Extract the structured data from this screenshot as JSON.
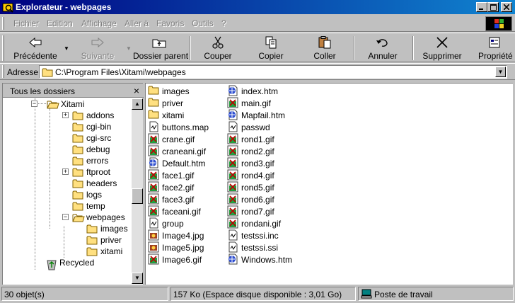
{
  "window": {
    "title": "Explorateur - webpages"
  },
  "menu": [
    "Fichier",
    "Edition",
    "Affichage",
    "Aller à",
    "Favoris",
    "Outils",
    "?"
  ],
  "toolbar": {
    "back": "Précédente",
    "forward": "Suivante",
    "up": "Dossier parent",
    "cut": "Couper",
    "copy": "Copier",
    "paste": "Coller",
    "undo": "Annuler",
    "delete": "Supprimer",
    "properties": "Propriété"
  },
  "address": {
    "label": "Adresse",
    "value": "C:\\Program Files\\Xitami\\webpages"
  },
  "folders_pane": {
    "title": "Tous les dossiers",
    "close": "×",
    "items": [
      {
        "label": "Xitami"
      },
      {
        "label": "addons"
      },
      {
        "label": "cgi-bin"
      },
      {
        "label": "cgi-src"
      },
      {
        "label": "debug"
      },
      {
        "label": "errors"
      },
      {
        "label": "ftproot"
      },
      {
        "label": "headers"
      },
      {
        "label": "logs"
      },
      {
        "label": "temp"
      },
      {
        "label": "webpages"
      },
      {
        "label": "images"
      },
      {
        "label": "priver"
      },
      {
        "label": "xitami"
      },
      {
        "label": "Recycled"
      }
    ]
  },
  "files": {
    "col1": [
      {
        "name": "images",
        "icon": "folder"
      },
      {
        "name": "priver",
        "icon": "folder"
      },
      {
        "name": "xitami",
        "icon": "folder"
      },
      {
        "name": "buttons.map",
        "icon": "file"
      },
      {
        "name": "crane.gif",
        "icon": "image"
      },
      {
        "name": "craneani.gif",
        "icon": "image"
      },
      {
        "name": "Default.htm",
        "icon": "html"
      },
      {
        "name": "face1.gif",
        "icon": "image"
      },
      {
        "name": "face2.gif",
        "icon": "image"
      },
      {
        "name": "face3.gif",
        "icon": "image"
      },
      {
        "name": "faceani.gif",
        "icon": "image"
      },
      {
        "name": "group",
        "icon": "file"
      },
      {
        "name": "Image4.jpg",
        "icon": "jpg"
      },
      {
        "name": "Image5.jpg",
        "icon": "jpg"
      },
      {
        "name": "Image6.gif",
        "icon": "image"
      }
    ],
    "col2": [
      {
        "name": "index.htm",
        "icon": "html"
      },
      {
        "name": "main.gif",
        "icon": "image"
      },
      {
        "name": "Mapfail.htm",
        "icon": "html"
      },
      {
        "name": "passwd",
        "icon": "file"
      },
      {
        "name": "rond1.gif",
        "icon": "image"
      },
      {
        "name": "rond2.gif",
        "icon": "image"
      },
      {
        "name": "rond3.gif",
        "icon": "image"
      },
      {
        "name": "rond4.gif",
        "icon": "image"
      },
      {
        "name": "rond5.gif",
        "icon": "image"
      },
      {
        "name": "rond6.gif",
        "icon": "image"
      },
      {
        "name": "rond7.gif",
        "icon": "image"
      },
      {
        "name": "rondani.gif",
        "icon": "image"
      },
      {
        "name": "testssi.inc",
        "icon": "file"
      },
      {
        "name": "testssi.ssi",
        "icon": "file"
      },
      {
        "name": "Windows.htm",
        "icon": "html"
      }
    ]
  },
  "status": {
    "count": "30 objet(s)",
    "size": "157 Ko (Espace disque disponible : 3,01 Go)",
    "location": "Poste de travail"
  }
}
